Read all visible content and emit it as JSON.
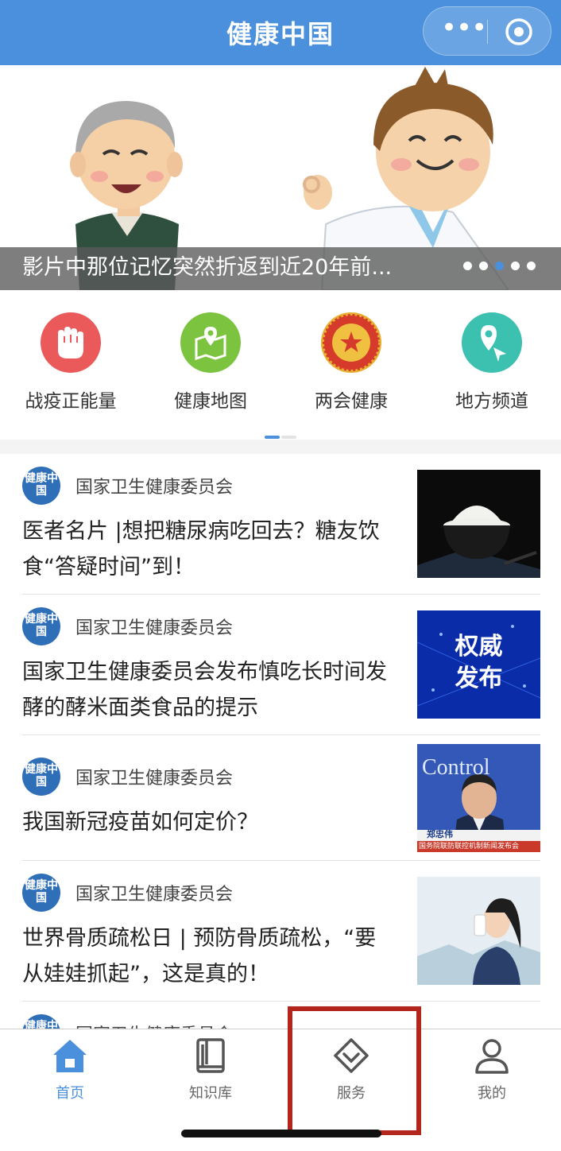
{
  "header": {
    "title": "健康中国",
    "more_icon": "more-dots-icon",
    "close_icon": "target-circle-icon"
  },
  "banner": {
    "caption": "影片中那位记忆突然折返到近20年前...",
    "dot_count": 5,
    "active_dot": 2
  },
  "quick_links": [
    {
      "label": "战疫正能量",
      "icon": "fist-icon",
      "color": "#ea5a5a"
    },
    {
      "label": "健康地图",
      "icon": "map-pin-icon",
      "color": "#7cc43f"
    },
    {
      "label": "两会健康",
      "icon": "star-emblem-icon",
      "color": "#d63a2a"
    },
    {
      "label": "地方频道",
      "icon": "location-arrow-icon",
      "color": "#3cc0b0"
    }
  ],
  "news": [
    {
      "source": "国家卫生健康委员会",
      "logo_text": "健康中国",
      "title": "医者名片 |想把糖尿病吃回去？糖友饮食“答疑时间”到！",
      "thumb": "rice-bowl-image"
    },
    {
      "source": "国家卫生健康委员会",
      "logo_text": "健康中国",
      "title": "国家卫生健康委员会发布慎吃长时间发酵的酵米面类食品的提示",
      "thumb": "authority-release-image",
      "thumb_text": "权威发布"
    },
    {
      "source": "国家卫生健康委员会",
      "logo_text": "健康中国",
      "title": "我国新冠疫苗如何定价？",
      "thumb": "press-conference-image",
      "thumb_text": "Control",
      "thumb_caption": "郑忠伟",
      "thumb_footer": "国务院联防联控机制新闻发布会"
    },
    {
      "source": "国家卫生健康委员会",
      "logo_text": "健康中国",
      "title": "世界骨质疏松日 | 预防骨质疏松，“要从娃娃抓起”，这是真的！",
      "thumb": "woman-drinking-image"
    },
    {
      "source": "国家卫生健康委员会",
      "logo_text": "健康中国",
      "title": "",
      "thumb": ""
    }
  ],
  "tabs": [
    {
      "label": "首页",
      "icon": "home-icon",
      "active": true
    },
    {
      "label": "知识库",
      "icon": "book-icon",
      "active": false
    },
    {
      "label": "服务",
      "icon": "diamond-icon",
      "active": false
    },
    {
      "label": "我的",
      "icon": "user-icon",
      "active": false
    }
  ],
  "colors": {
    "brand": "#4a90dc",
    "highlight": "#b3261e"
  }
}
